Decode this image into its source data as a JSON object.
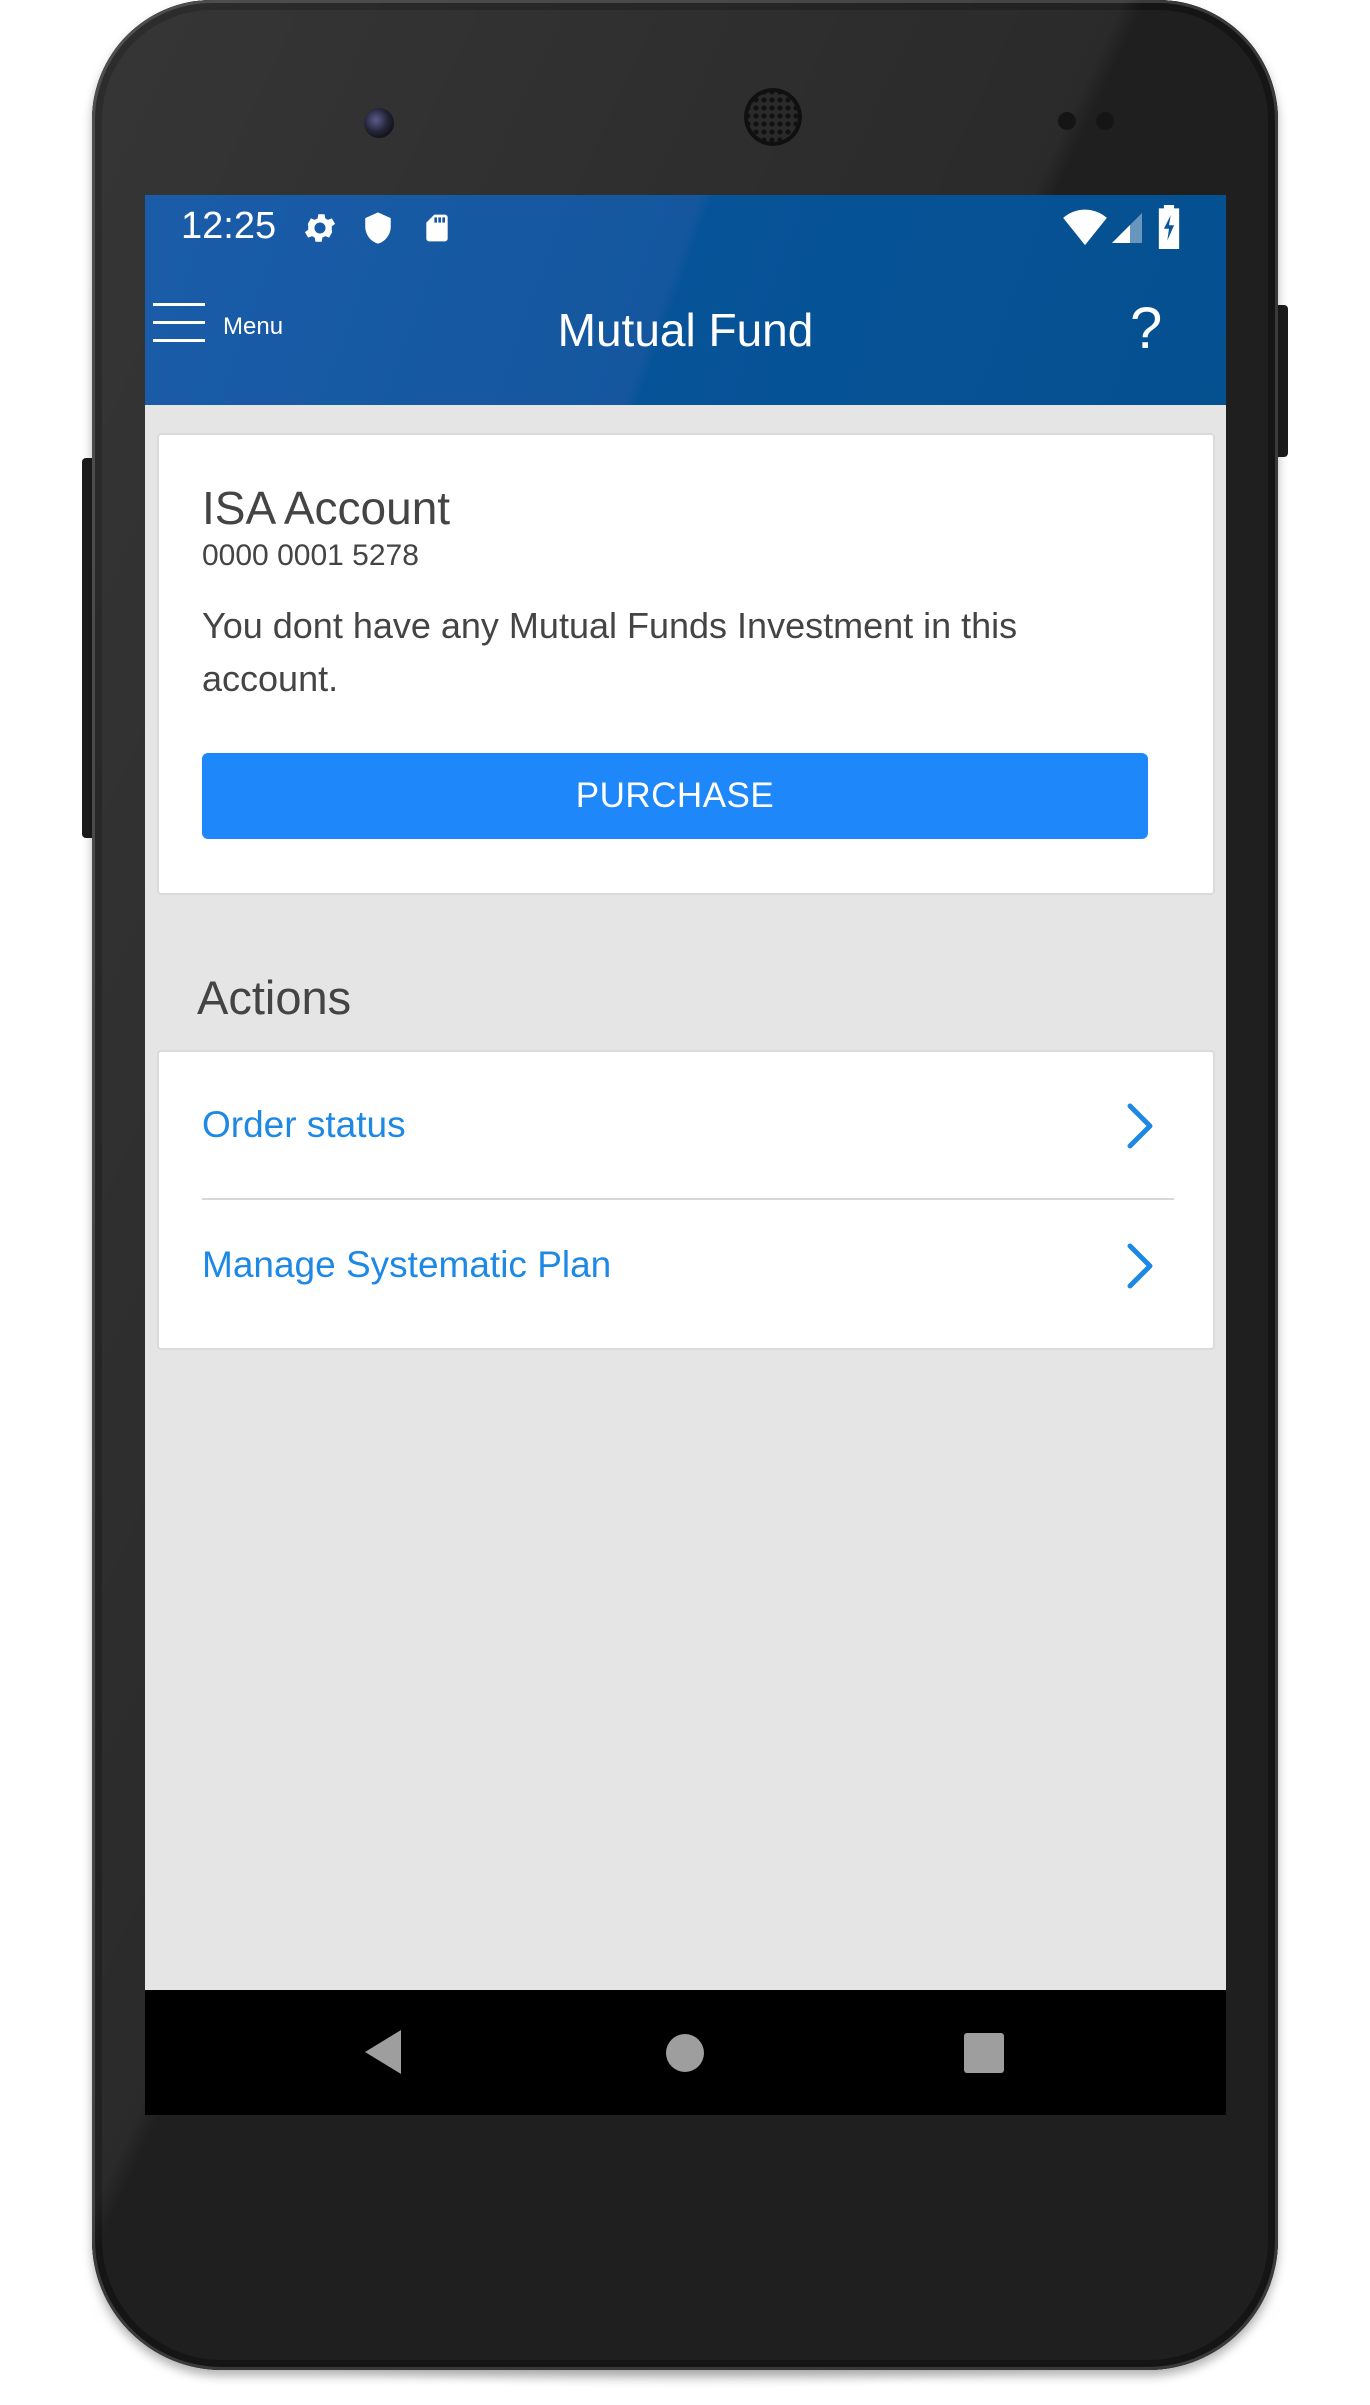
{
  "status_bar": {
    "time": "12:25",
    "left_icons": [
      "settings-icon",
      "shield-icon",
      "sd-card-icon"
    ],
    "right_icons": [
      "wifi-icon",
      "cellular-signal-icon",
      "battery-charging-icon"
    ]
  },
  "app_bar": {
    "menu_label": "Menu",
    "title": "Mutual Fund",
    "help_label": "?"
  },
  "account_card": {
    "title": "ISA Account",
    "account_number": "0000 0001 5278",
    "message": "You dont have any Mutual Funds Investment in this account.",
    "purchase_label": "PURCHASE"
  },
  "actions": {
    "heading": "Actions",
    "items": [
      {
        "label": "Order status",
        "icon": "chevron-right-icon"
      },
      {
        "label": "Manage Systematic Plan",
        "icon": "chevron-right-icon"
      }
    ]
  },
  "nav_bar": {
    "icons": [
      "back-icon",
      "home-icon",
      "recents-icon"
    ]
  },
  "colors": {
    "app_bar": "#0b559c",
    "accent": "#1e88fb",
    "link": "#1e88e5",
    "background": "#e5e5e5"
  }
}
